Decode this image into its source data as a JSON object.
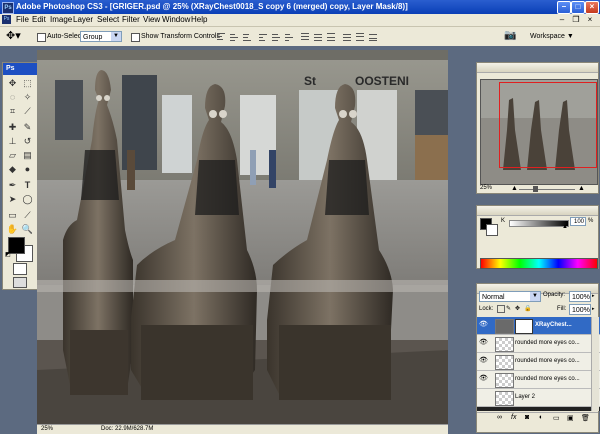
{
  "window": {
    "app_icon": "Ps",
    "title": "Adobe Photoshop CS3 - [GRIGER.psd @ 25% (XRayChest0018_S copy 6 (merged) copy, Layer Mask/8)]",
    "controls": [
      "minimize",
      "maximize",
      "close"
    ]
  },
  "menu": {
    "items": [
      "File",
      "Edit",
      "Image",
      "Layer",
      "Select",
      "Filter",
      "View",
      "Window",
      "Help"
    ]
  },
  "options_bar": {
    "auto_select_label": "Auto-Select:",
    "auto_select_value": "Group",
    "show_transform_label": "Show Transform Controls",
    "workspace_label": "Workspace"
  },
  "toolbox": {
    "header": "Ps"
  },
  "document": {
    "status_zoom": "25%",
    "status_doc": "Doc: 22.9M/628.7M"
  },
  "photo": {
    "sign_text_1": "St",
    "sign_text_2": "OOSTENI"
  },
  "navigator": {
    "zoom": "25%"
  },
  "color_panel": {
    "k_label": "K",
    "k_value": "100",
    "k_unit": "%"
  },
  "layers_panel": {
    "blend_mode": "Normal",
    "opacity_label": "Opacity:",
    "opacity_value": "100%",
    "lock_label": "Lock:",
    "fill_label": "Fill:",
    "fill_value": "100%",
    "layers": [
      {
        "name": "XRayChest...",
        "selected": true
      },
      {
        "name": "rounded more eyes co...",
        "selected": false
      },
      {
        "name": "rounded more eyes co...",
        "selected": false
      },
      {
        "name": "rounded more eyes co...",
        "selected": false
      },
      {
        "name": "Layer 2",
        "selected": false
      }
    ]
  },
  "colors": {
    "titlebar": "#0a3fb6",
    "chrome": "#ece9d8",
    "selection": "#316ac5",
    "workspace_bg": "#5c6a80"
  }
}
